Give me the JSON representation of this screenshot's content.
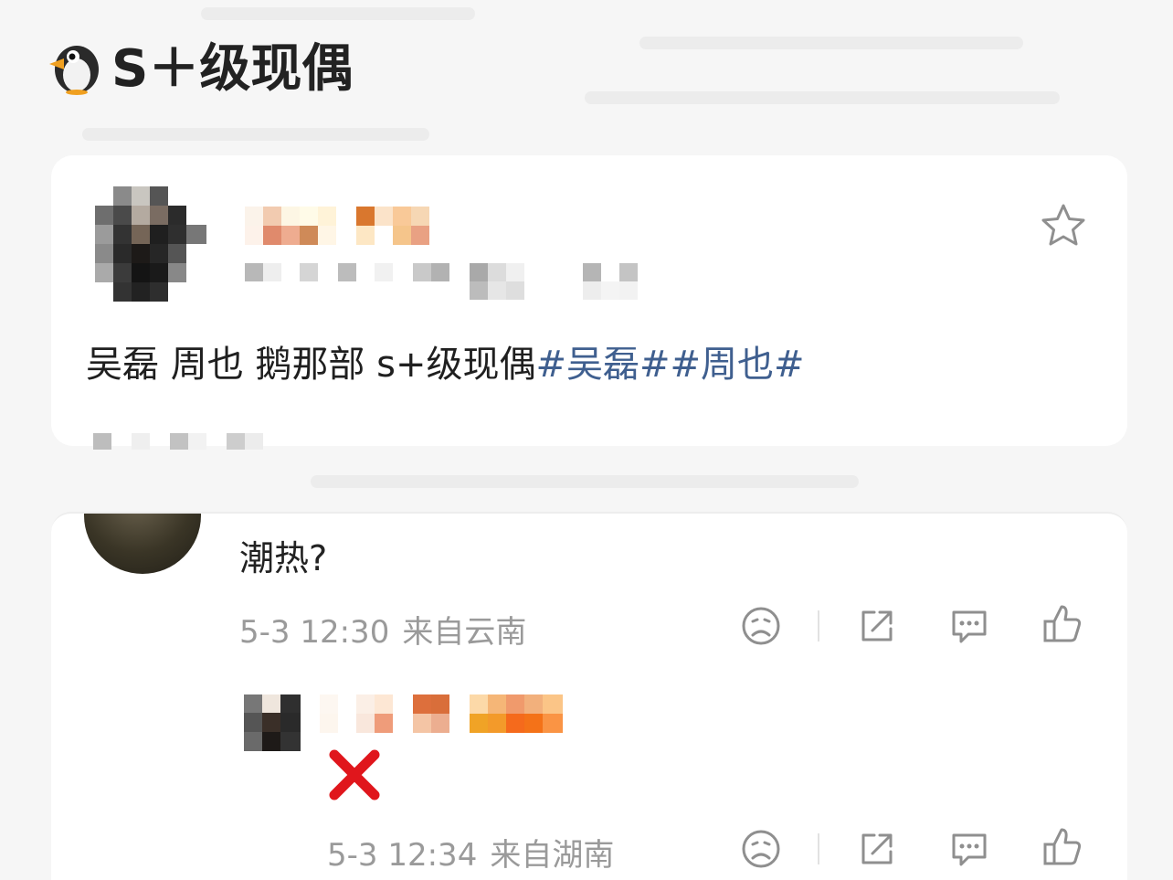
{
  "title": {
    "text": "S＋级现偶",
    "emoji": "penguin-icon"
  },
  "post": {
    "text_plain": "吴磊 周也 鹅那部 s+级现偶",
    "tags": [
      "#吴磊#",
      "#周也#"
    ],
    "favorite_icon": "star-icon"
  },
  "comments": [
    {
      "text": "潮热?",
      "time": "5-3 12:30",
      "location": "来自云南"
    },
    {
      "emoji": "red-cross-mark-icon",
      "time": "5-3 12:34",
      "location": "来自湖南"
    }
  ],
  "actions": {
    "sad": "sad-face-icon",
    "share": "share-icon",
    "reply": "comment-icon",
    "like": "thumbs-up-icon"
  },
  "colors": {
    "tag": "#3f5f8f",
    "meta": "#9a9a9a",
    "icon": "#8f8f8f",
    "red_x": "#e0161c"
  }
}
